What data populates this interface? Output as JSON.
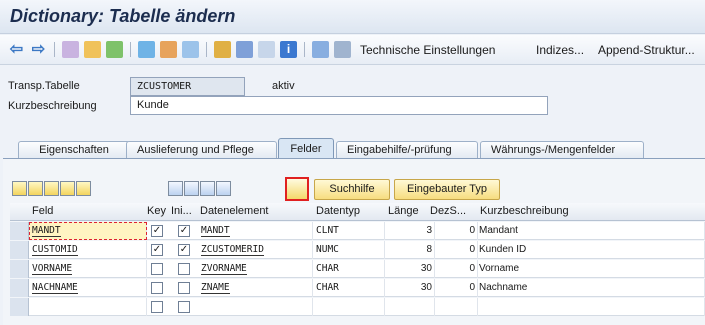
{
  "window": {
    "title": "Dictionary: Tabelle ändern"
  },
  "toolbar": {
    "buttons": [
      "Technische Einstellungen",
      "Indizes...",
      "Append-Struktur..."
    ]
  },
  "header": {
    "table_label": "Transp.Tabelle",
    "table_value": "ZCUSTOMER",
    "status": "aktiv",
    "desc_label": "Kurzbeschreibung",
    "desc_value": "Kunde"
  },
  "tabs": [
    "Eigenschaften",
    "Auslieferung und Pflege",
    "Felder",
    "Eingabehilfe/-prüfung",
    "Währungs-/Mengenfelder"
  ],
  "active_tab": "Felder",
  "table_toolbar": {
    "search_help": "Suchhilfe",
    "builtin_type": "Eingebauter Typ"
  },
  "columns": [
    "Feld",
    "Key",
    "Ini...",
    "Datenelement",
    "Datentyp",
    "Länge",
    "DezS...",
    "Kurzbeschreibung"
  ],
  "rows": [
    {
      "field": "MANDT",
      "key": true,
      "init": true,
      "element": "MANDT",
      "type": "CLNT",
      "length": "3",
      "dec": "0",
      "desc": "Mandant"
    },
    {
      "field": "CUSTOMID",
      "key": true,
      "init": true,
      "element": "ZCUSTOMERID",
      "type": "NUMC",
      "length": "8",
      "dec": "0",
      "desc": "Kunden ID"
    },
    {
      "field": "VORNAME",
      "key": false,
      "init": false,
      "element": "ZVORNAME",
      "type": "CHAR",
      "length": "30",
      "dec": "0",
      "desc": "Vorname"
    },
    {
      "field": "NACHNAME",
      "key": false,
      "init": false,
      "element": "ZNAME",
      "type": "CHAR",
      "length": "30",
      "dec": "0",
      "desc": "Nachname"
    },
    {
      "field": "",
      "key": false,
      "init": false,
      "element": "",
      "type": "",
      "length": "",
      "dec": "",
      "desc": ""
    }
  ],
  "icons": [
    "back-icon",
    "forward-icon",
    "other-object-icon",
    "display-change-icon",
    "activate-icon",
    "check-icon",
    "where-used-icon",
    "hierarchy-icon",
    "info-icon",
    "search-help-key-icon"
  ],
  "colors": {
    "title": "#1c2d4f",
    "accent_yellow": "#f7dd80",
    "highlight": "#e02020"
  }
}
